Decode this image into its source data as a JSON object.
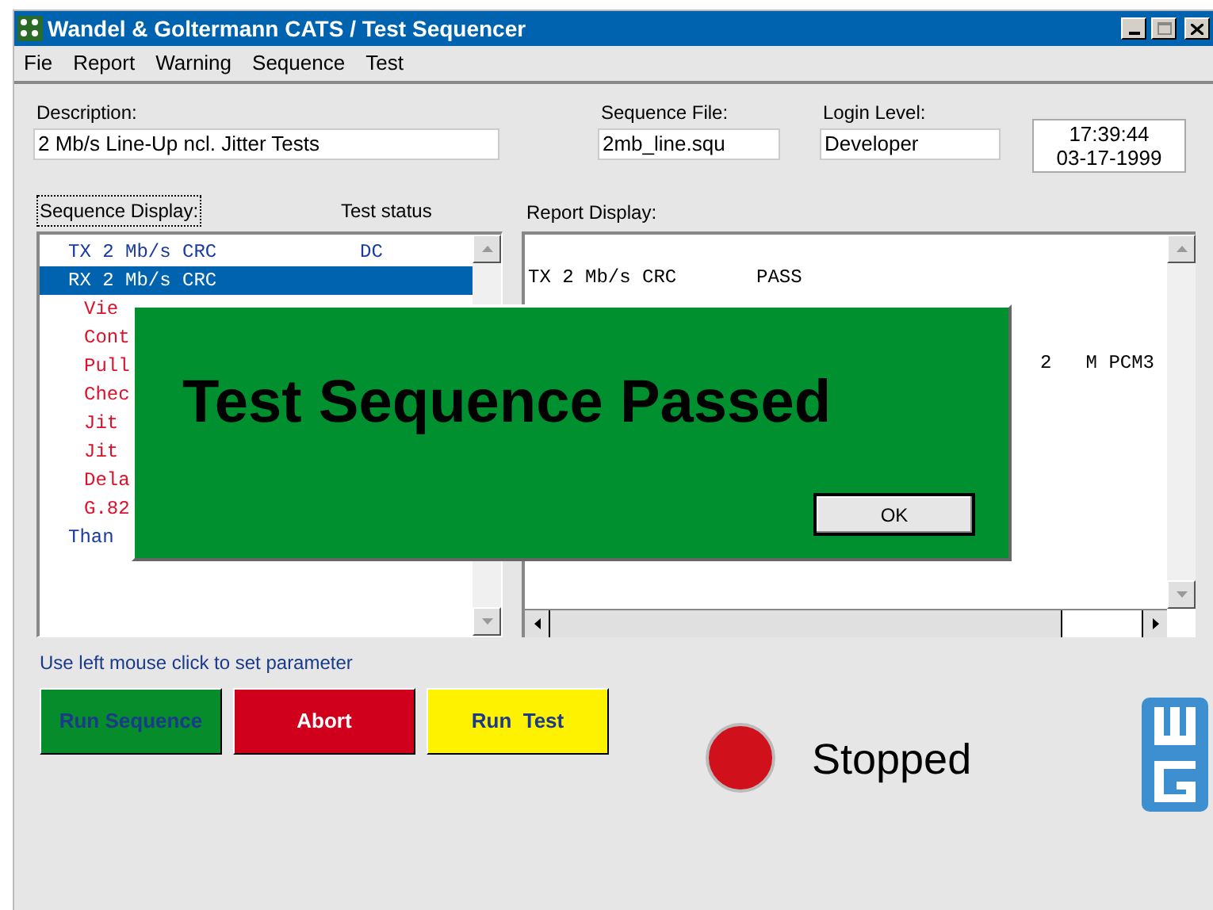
{
  "window": {
    "title": "Wandel & Goltermann CATS / Test Sequencer"
  },
  "menu": [
    "Fie",
    "Report",
    "Warning",
    "Sequence",
    "Test"
  ],
  "fields": [
    {
      "label": "Description:",
      "value": "2 Mb/s Line-Up ncl. Jitter Tests"
    },
    {
      "label": "Sequence File:",
      "value": "2mb_line.squ"
    },
    {
      "label": "Login Level:",
      "value": "Developer"
    }
  ],
  "clock": {
    "time": "17:39:44",
    "date": "03-17-1999"
  },
  "sequence_display": {
    "label": "Sequence Display:",
    "status_label": "Test status",
    "items": [
      {
        "kind": "group",
        "text": "TX 2 Mb/s CRC",
        "status": "DC",
        "selected": false
      },
      {
        "kind": "group",
        "text": "RX 2 Mb/s CRC",
        "selected": true
      },
      {
        "kind": "step",
        "text": "Vie",
        "selected": false
      },
      {
        "kind": "step",
        "text": "Cont",
        "selected": false
      },
      {
        "kind": "step",
        "text": "Pull",
        "selected": false
      },
      {
        "kind": "step",
        "text": "Chec",
        "selected": false
      },
      {
        "kind": "step",
        "text": "Jit",
        "selected": false
      },
      {
        "kind": "step",
        "text": "Jit",
        "selected": false
      },
      {
        "kind": "step",
        "text": "Dela",
        "selected": false
      },
      {
        "kind": "step",
        "text": "G.82",
        "selected": false
      },
      {
        "kind": "group",
        "text": "Than",
        "selected": false
      }
    ]
  },
  "report_display": {
    "label": "Report Display:",
    "lines": [
      {
        "text": "TX 2 Mb/s CRC",
        "result": "PASS"
      },
      {
        "text": "2   M PCM3"
      }
    ]
  },
  "hint": "Use left mouse click to set parameter",
  "buttons": [
    {
      "kind": "run",
      "label": "Run Sequence"
    },
    {
      "kind": "abort",
      "label": "Abort"
    },
    {
      "kind": "test",
      "label": "Run  Test"
    }
  ],
  "state": {
    "text": "Stopped"
  },
  "dialog": {
    "message": "Test Sequence Passed",
    "button": "OK"
  }
}
